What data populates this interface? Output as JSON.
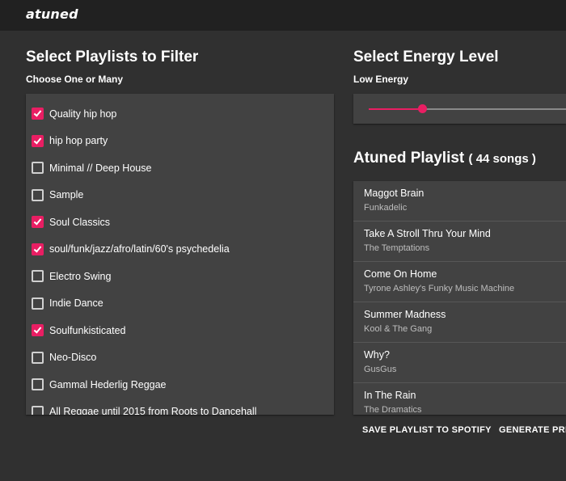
{
  "app": {
    "logo": "atuned"
  },
  "playlists_section": {
    "title": "Select Playlists to Filter",
    "subtitle": "Choose One or Many",
    "items": [
      {
        "label": "Quality hip hop",
        "checked": true
      },
      {
        "label": "hip hop party",
        "checked": true
      },
      {
        "label": "Minimal // Deep House",
        "checked": false
      },
      {
        "label": "Sample",
        "checked": false
      },
      {
        "label": "Soul Classics",
        "checked": true
      },
      {
        "label": "soul/funk/jazz/afro/latin/60's psychedelia",
        "checked": true
      },
      {
        "label": "Electro Swing",
        "checked": false
      },
      {
        "label": "Indie Dance",
        "checked": false
      },
      {
        "label": "Soulfunkisticated",
        "checked": true
      },
      {
        "label": "Neo-Disco",
        "checked": false
      },
      {
        "label": "Gammal Hederlig Reggae",
        "checked": false
      },
      {
        "label": "All Reggae until 2015 from Roots to Dancehall",
        "checked": false
      }
    ]
  },
  "energy_section": {
    "title": "Select Energy Level",
    "level_label": "Low Energy",
    "slider_value": 0.27
  },
  "atuned_playlist": {
    "title": "Atuned Playlist",
    "count_text": "( 44 songs )",
    "songs": [
      {
        "title": "Maggot Brain",
        "artist": "Funkadelic"
      },
      {
        "title": "Take A Stroll Thru Your Mind",
        "artist": "The Temptations"
      },
      {
        "title": "Come On Home",
        "artist": "Tyrone Ashley's Funky Music Machine"
      },
      {
        "title": "Summer Madness",
        "artist": "Kool & The Gang"
      },
      {
        "title": "Why?",
        "artist": "GusGus"
      },
      {
        "title": "In The Rain",
        "artist": "The Dramatics"
      }
    ]
  },
  "actions": {
    "save_label": "SAVE PLAYLIST TO SPOTIFY",
    "generate_label": "GENERATE PREV"
  },
  "colors": {
    "accent": "#e91e63",
    "background": "#303030",
    "panel": "#424242",
    "topbar": "#212121"
  }
}
